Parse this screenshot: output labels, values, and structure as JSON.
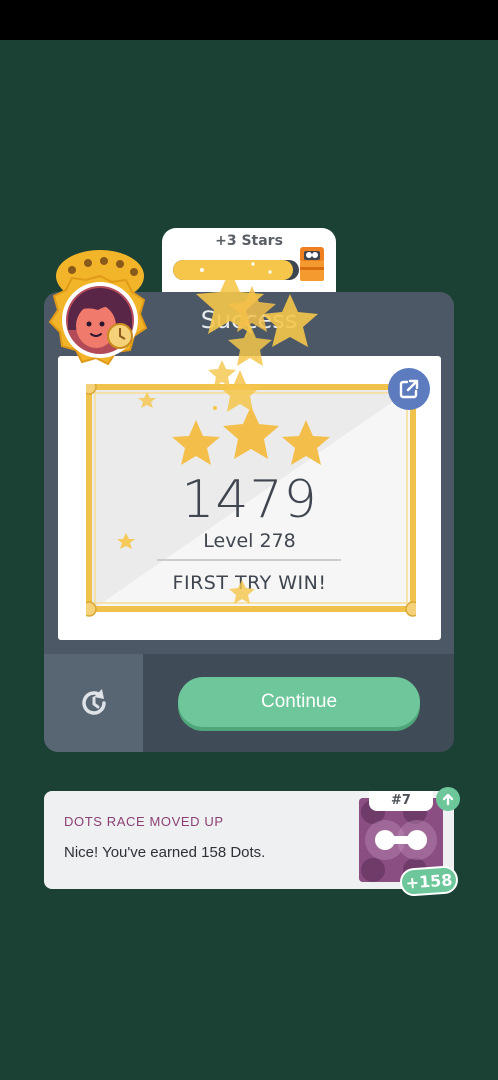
{
  "stars_tab": {
    "label": "+3 Stars",
    "progress": 0.95
  },
  "card": {
    "title": "Success",
    "score": "1479",
    "level": "Level 278",
    "result": "FIRST TRY WIN!",
    "continue_label": "Continue",
    "stars_earned": 3
  },
  "race": {
    "title": "DOTS RACE MOVED UP",
    "message": "Nice! You've earned 158 Dots.",
    "rank": "#7",
    "dots_gained": "+158"
  },
  "colors": {
    "background": "#1b4034",
    "card": "#4c5866",
    "accent_green": "#6dc79a",
    "star_gold": "#f5c64a",
    "race_purple": "#8c3f74"
  },
  "icons": {
    "share": "share-icon",
    "retry": "retry-icon",
    "chest": "treasure-chest-icon",
    "up": "arrow-up-icon"
  }
}
